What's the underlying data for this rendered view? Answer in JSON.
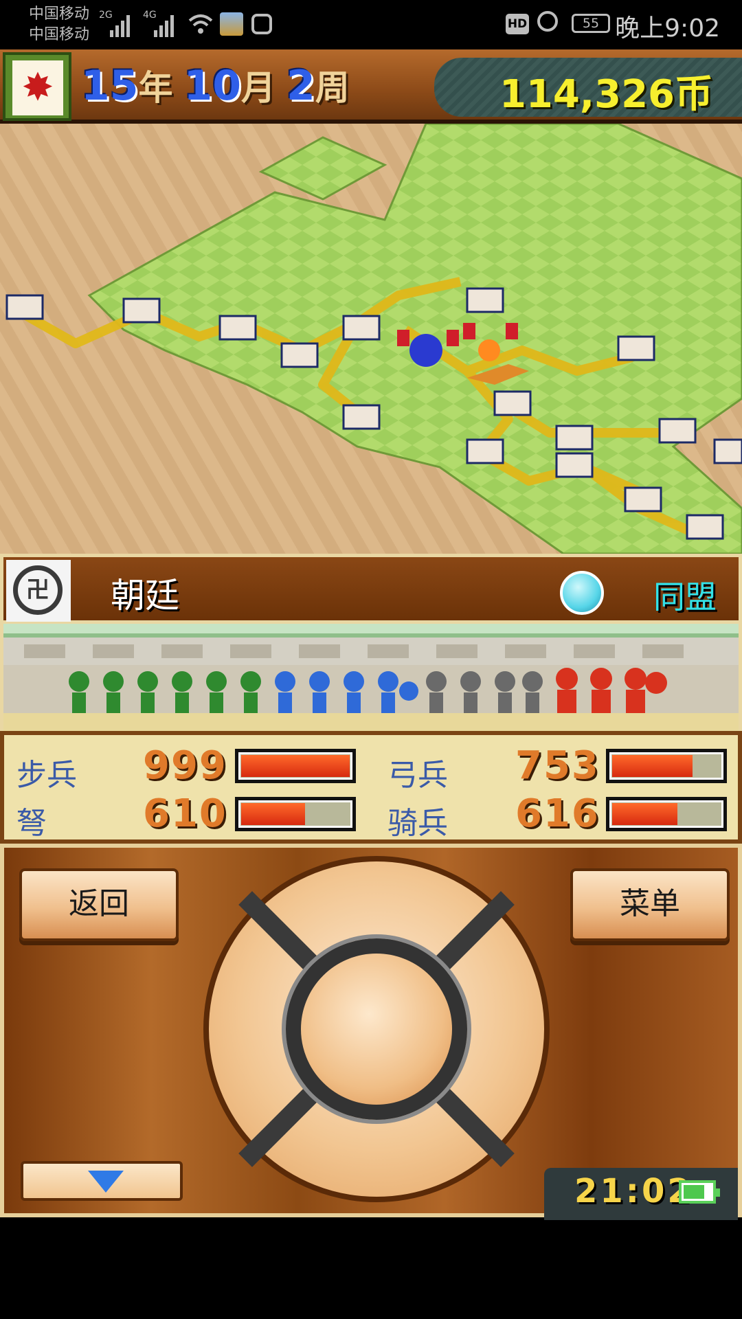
{
  "status_bar": {
    "carrier1": "中国移动",
    "carrier2": "中国移动",
    "net1": "2G",
    "net2": "4G",
    "hd": "HD",
    "battery": "55",
    "time": "晚上9:02"
  },
  "header": {
    "year": "15",
    "year_unit": "年",
    "month": "10",
    "month_unit": "月",
    "week": "2",
    "week_unit": "周",
    "money": "114,326币"
  },
  "faction": {
    "name": "朝廷",
    "relation": "同盟"
  },
  "stats": [
    {
      "label": "步兵",
      "value": "999",
      "ratio": 1.0
    },
    {
      "label": "弓兵",
      "value": "753",
      "ratio": 0.75
    },
    {
      "label": "弩",
      "value": "610",
      "ratio": 0.61
    },
    {
      "label": "骑兵",
      "value": "616",
      "ratio": 0.62
    }
  ],
  "controls": {
    "back": "返回",
    "menu": "菜单",
    "clock": "21:02"
  },
  "colors": {
    "money": "#f7ef2e",
    "alliance": "#33e2e8",
    "bar_fill": "#e8401a"
  }
}
